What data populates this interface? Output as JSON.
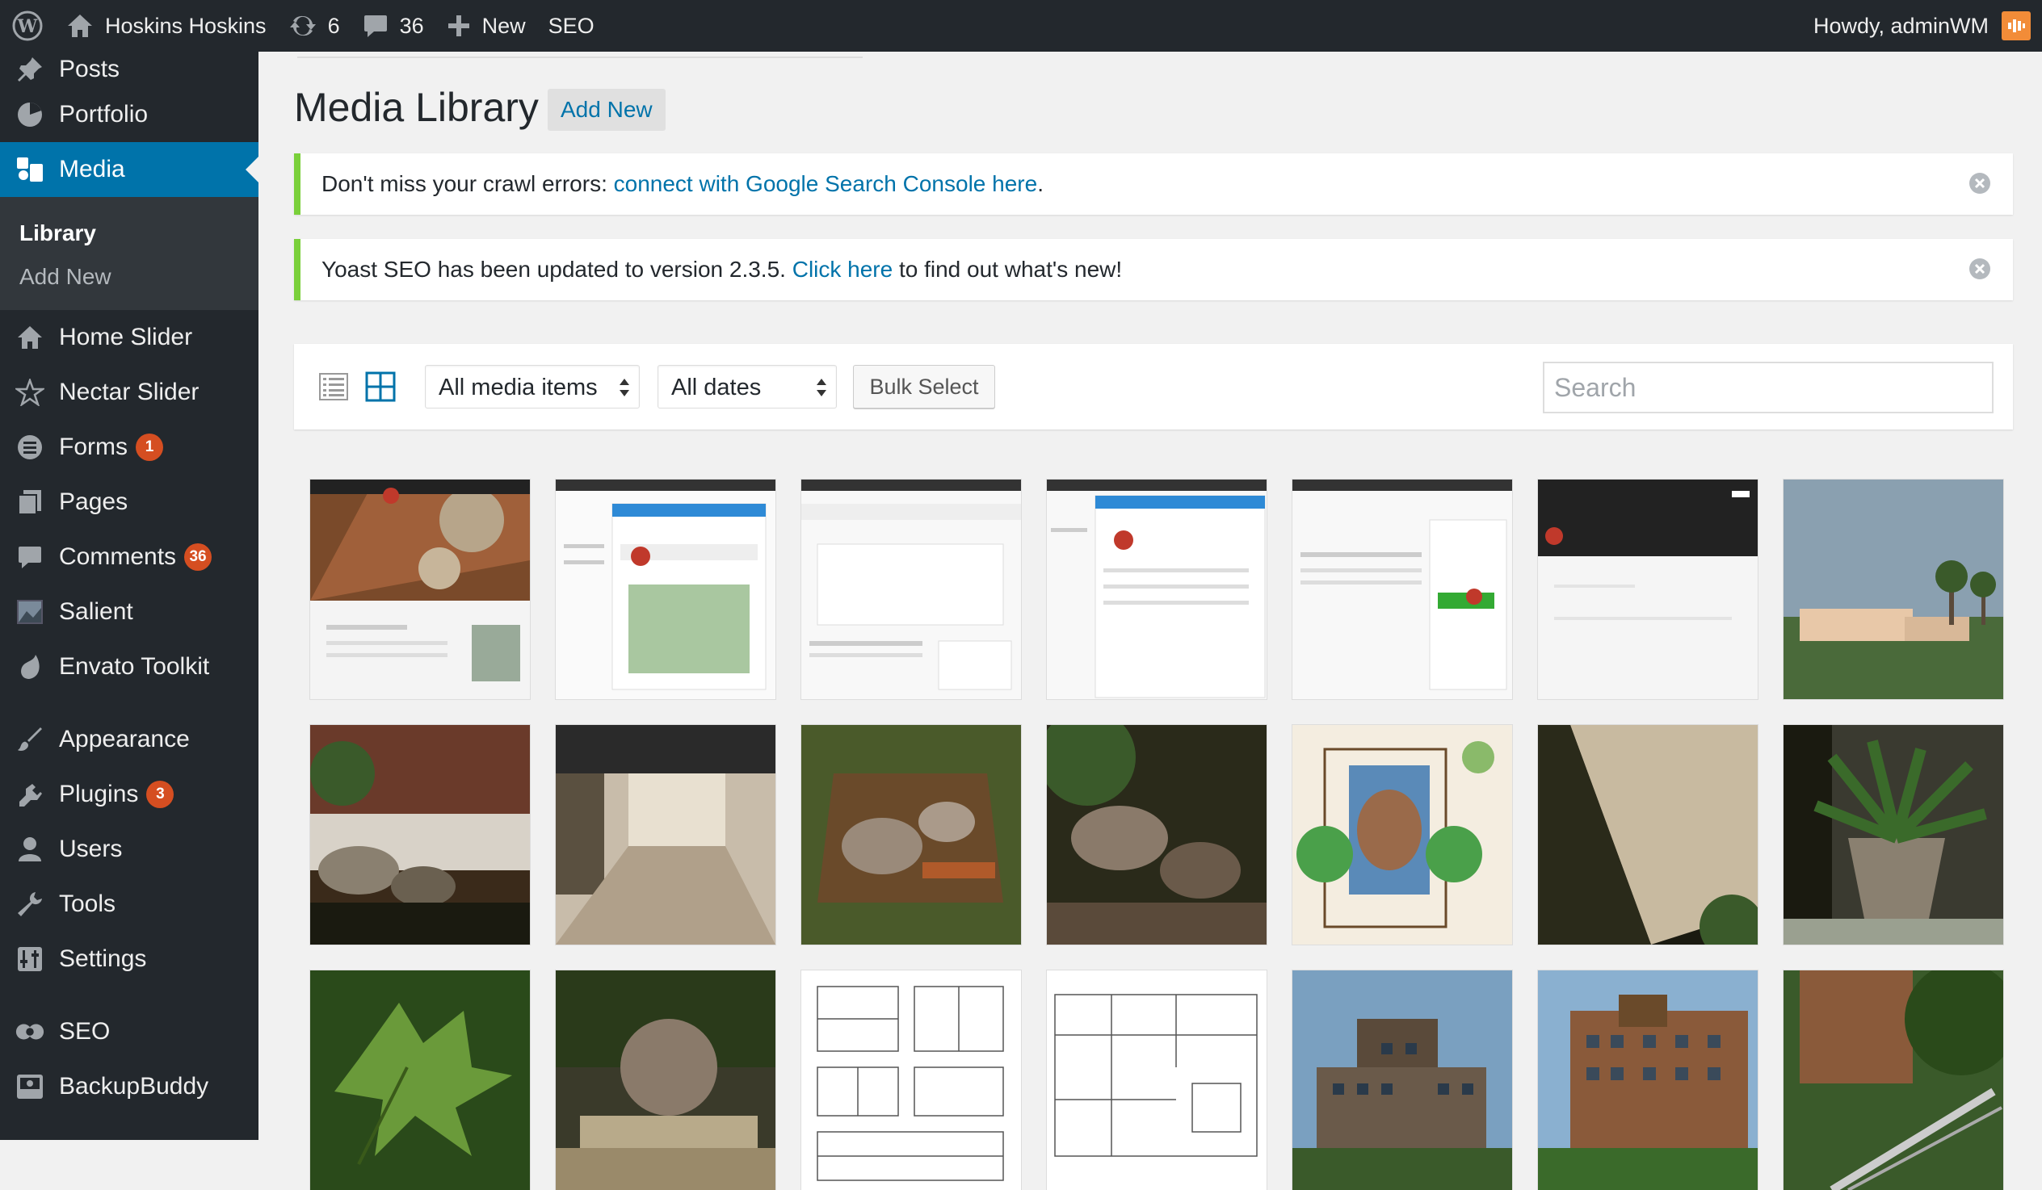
{
  "admin_bar": {
    "site_name": "Hoskins Hoskins",
    "updates_count": "6",
    "comments_count": "36",
    "new_label": "New",
    "seo_label": "SEO",
    "greeting": "Howdy, adminWM"
  },
  "sidebar": {
    "items": [
      {
        "label": "Posts",
        "icon": "pin-icon"
      },
      {
        "label": "Portfolio",
        "icon": "portfolio-icon"
      },
      {
        "label": "Media",
        "icon": "media-icon",
        "current": true
      },
      {
        "label": "Home Slider",
        "icon": "home-icon"
      },
      {
        "label": "Nectar Slider",
        "icon": "star-icon"
      },
      {
        "label": "Forms",
        "icon": "forms-icon",
        "badge": "1"
      },
      {
        "label": "Pages",
        "icon": "pages-icon"
      },
      {
        "label": "Comments",
        "icon": "comment-icon",
        "badge": "36"
      },
      {
        "label": "Salient",
        "icon": "salient-icon"
      },
      {
        "label": "Envato Toolkit",
        "icon": "drop-icon"
      },
      {
        "label": "Appearance",
        "icon": "brush-icon"
      },
      {
        "label": "Plugins",
        "icon": "plugin-icon",
        "badge": "3"
      },
      {
        "label": "Users",
        "icon": "user-icon"
      },
      {
        "label": "Tools",
        "icon": "wrench-icon"
      },
      {
        "label": "Settings",
        "icon": "settings-icon"
      },
      {
        "label": "SEO",
        "icon": "seo-icon"
      },
      {
        "label": "BackupBuddy",
        "icon": "backup-icon"
      }
    ],
    "submenu": {
      "library": "Library",
      "add_new": "Add New"
    }
  },
  "page": {
    "title": "Media Library",
    "add_new": "Add New"
  },
  "notices": {
    "crawl_prefix": "Don't miss your crawl errors: ",
    "crawl_link": "connect with Google Search Console here",
    "crawl_suffix": ".",
    "yoast_prefix": "Yoast SEO has been updated to version 2.3.5. ",
    "yoast_link": "Click here",
    "yoast_suffix": " to find out what's new!"
  },
  "toolbar": {
    "media_filter": "All media items",
    "date_filter": "All dates",
    "bulk_select": "Bulk Select",
    "search_placeholder": "Search"
  },
  "colors": {
    "admin_dark": "#23282d",
    "wp_blue": "#0073aa",
    "notice_green": "#7ad03a",
    "badge_orange": "#d54e21"
  }
}
